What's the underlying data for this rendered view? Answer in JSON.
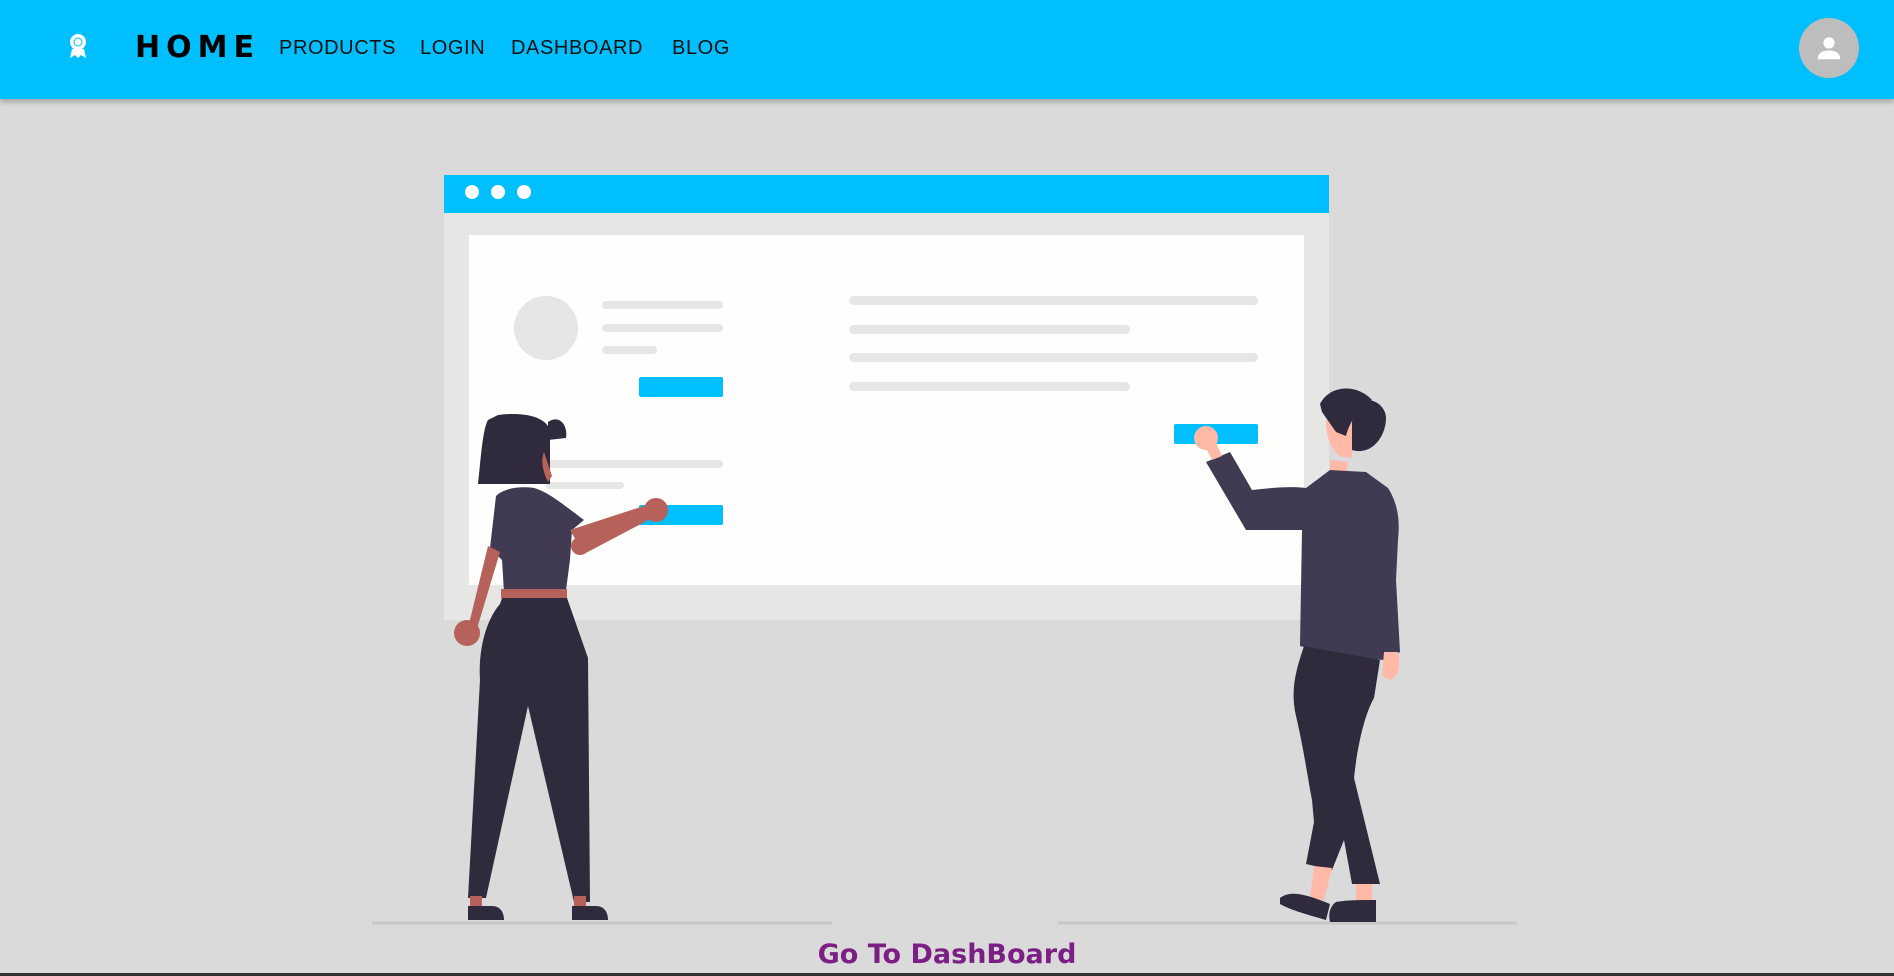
{
  "header": {
    "brand": "HOME",
    "logo_icon": "award-badge-icon",
    "nav": [
      {
        "label": "PRODUCTS"
      },
      {
        "label": "LOGIN"
      },
      {
        "label": "DASHBOARD"
      },
      {
        "label": "BLOG"
      }
    ],
    "avatar_icon": "person-icon"
  },
  "main": {
    "cta_label": "Go To DashBoard",
    "illustration": "two-people-at-web-browser-illustration"
  },
  "colors": {
    "accent": "#00bfff",
    "background": "#dadada",
    "cta_text": "#7b1f84",
    "avatar_bg": "#bdbdbd"
  }
}
